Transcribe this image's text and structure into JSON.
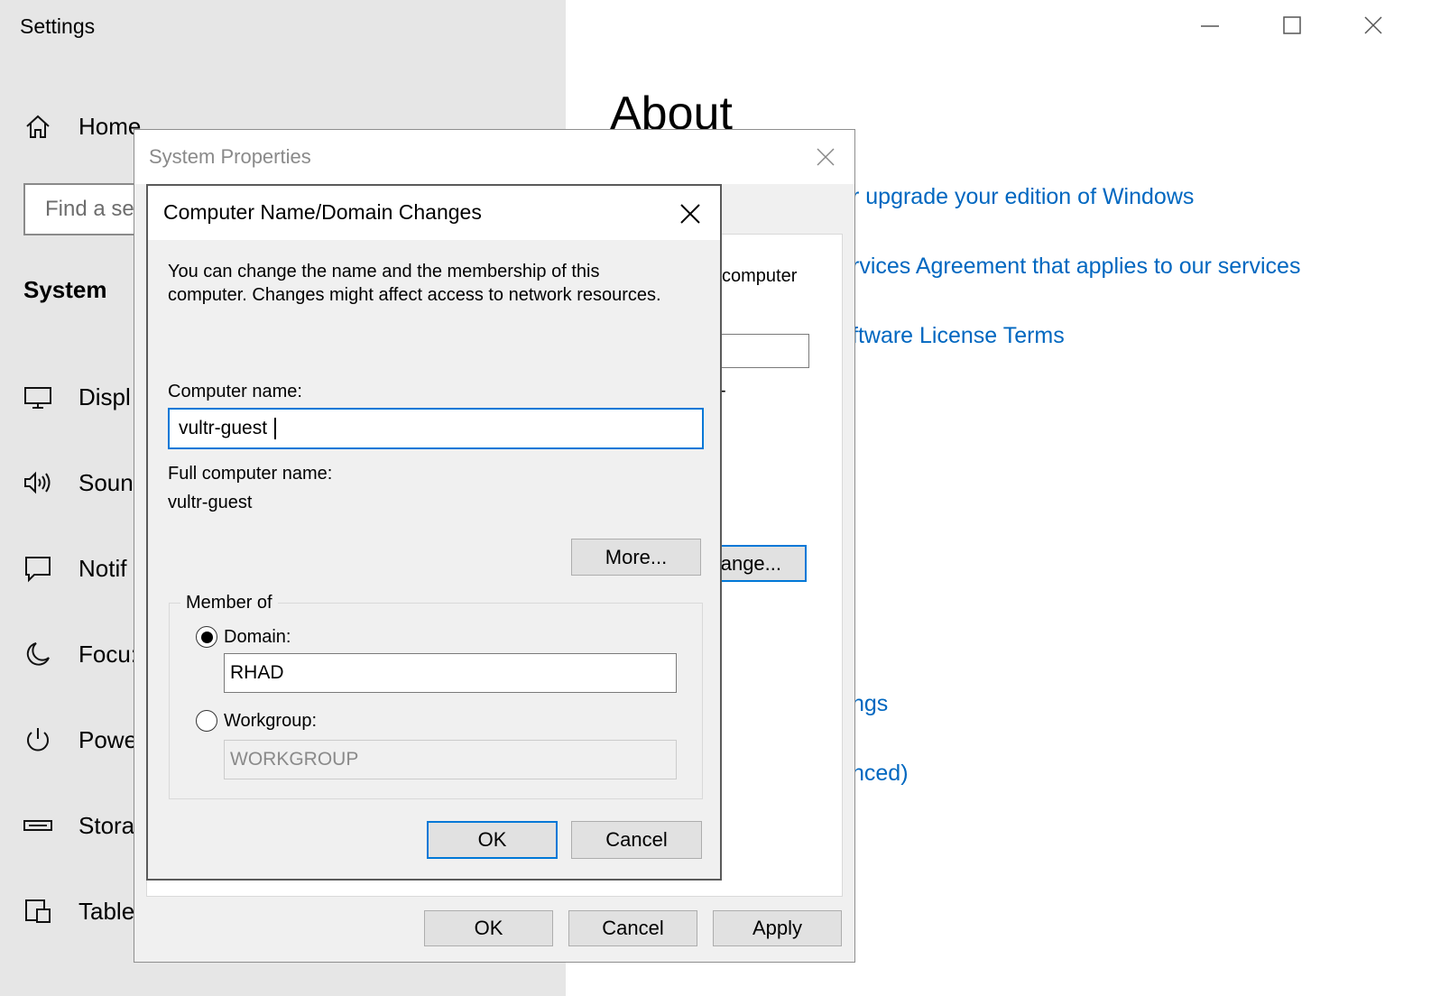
{
  "settings": {
    "app_title": "Settings",
    "nav": {
      "home": "Home",
      "search_placeholder": "Find a se",
      "section": "System",
      "items": [
        "Displ",
        "Soun",
        "Notif",
        "Focu:",
        "Powe",
        "Stora",
        "Table"
      ]
    },
    "page_title": "About",
    "links": {
      "upgrade": "r upgrade your edition of Windows",
      "services": "rvices Agreement that applies to our services",
      "license": "ftware License Terms",
      "settings": "ngs",
      "advanced": "nced)"
    }
  },
  "system_properties": {
    "title": "System Properties",
    "bg_label": "computer",
    "bg_dash": "-",
    "change_button": "ange...",
    "ok": "OK",
    "cancel": "Cancel",
    "apply": "Apply"
  },
  "domain_dialog": {
    "title": "Computer Name/Domain Changes",
    "description_line1": "You can change the name and the membership of this",
    "description_line2": "computer. Changes might affect access to network resources.",
    "computer_name_label": "Computer name:",
    "computer_name_value": "vultr-guest",
    "full_name_label": "Full computer name:",
    "full_name_value": "vultr-guest",
    "more_button": "More...",
    "member_of_label": "Member of",
    "domain_label": "Domain:",
    "domain_value": "RHAD",
    "domain_selected": true,
    "workgroup_label": "Workgroup:",
    "workgroup_value": "WORKGROUP",
    "ok": "OK",
    "cancel": "Cancel"
  },
  "colors": {
    "accent": "#0078d7",
    "link": "#0067c0",
    "sidebar_bg": "#e6e6e6",
    "dialog_bg": "#f0f0f0"
  },
  "icons": [
    "home-icon",
    "display-icon",
    "sound-icon",
    "notifications-icon",
    "focus-assist-icon",
    "power-icon",
    "storage-icon",
    "tablet-icon",
    "minimize-icon",
    "maximize-icon",
    "close-icon"
  ]
}
